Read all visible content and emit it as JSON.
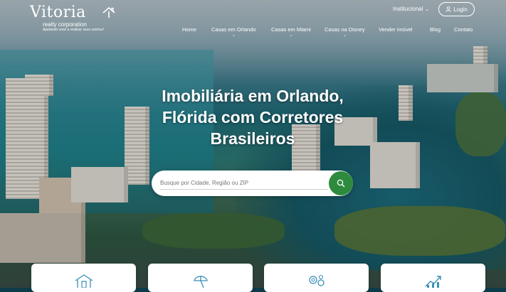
{
  "logo": {
    "name": "Vitoria",
    "subtitle": "realty corporation",
    "tagline": "Ajudando você a realizar seus sonhos!"
  },
  "top": {
    "institutional": "Institucional",
    "login": "Login"
  },
  "nav": [
    {
      "label": "Home",
      "dropdown": false
    },
    {
      "label": "Casas em Orlando",
      "dropdown": true
    },
    {
      "label": "Casas em Miami",
      "dropdown": true
    },
    {
      "label": "Casas na Disney",
      "dropdown": true
    },
    {
      "label": "Vender imóvel",
      "dropdown": false
    },
    {
      "label": "Blog",
      "dropdown": false
    },
    {
      "label": "Contato",
      "dropdown": false
    }
  ],
  "hero": {
    "headline": "Imobiliária em Orlando, Flórida com Corretores Brasileiros"
  },
  "search": {
    "placeholder": "Busque por Cidade, Região ou ZIP"
  },
  "cards": [
    {
      "icon": "house-icon"
    },
    {
      "icon": "beach-umbrella-icon"
    },
    {
      "icon": "gears-icon"
    },
    {
      "icon": "growth-chart-icon"
    }
  ],
  "colors": {
    "accent": "#2e8b3e",
    "text_light": "#ffffff"
  }
}
